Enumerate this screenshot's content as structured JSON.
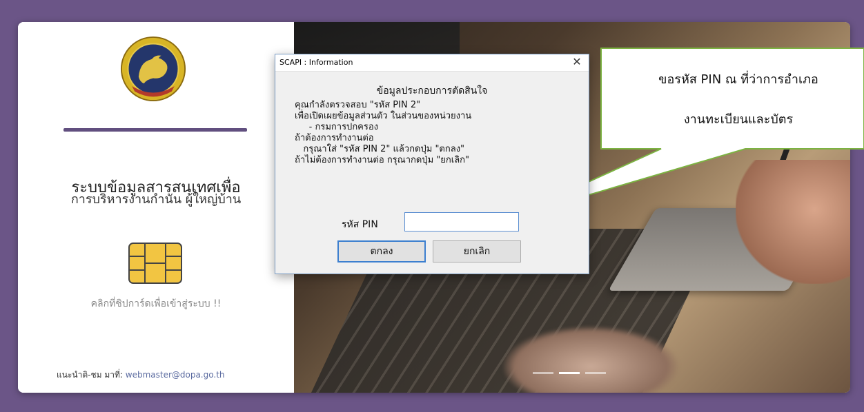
{
  "left_panel": {
    "emblem_alt": "กรมการปกครอง",
    "title_line1": "ระบบข้อมูลสารสนเทศเพื่อ",
    "title_line2": "การบริหารงานกำนัน ผู้ใหญ่บ้าน",
    "chip_icon": "smartcard-chip-icon",
    "click_hint": "คลิกที่ชิปการ์ดเพื่อเข้าสู่ระบบ !!",
    "footer_label": "แนะนำติ-ชม มาที่:",
    "footer_email": "webmaster@dopa.go.th"
  },
  "dialog": {
    "title": "SCAPI : Information",
    "close_label": "✕",
    "heading": "ข้อมูลประกอบการตัดสินใจ",
    "body_lines": [
      "คุณกำลังตรวจสอบ \"รหัส PIN 2\"",
      "เพื่อเปิดเผยข้อมูลส่วนตัว ในส่วนของหน่วยงาน",
      "     - กรมการปกครอง",
      "ถ้าต้องการทำงานต่อ",
      "   กรุณาใส่ \"รหัส PIN 2\" แล้วกดปุ่ม \"ตกลง\"",
      "ถ้าไม่ต้องการทำงานต่อ กรุณากดปุ่ม \"ยกเลิก\""
    ],
    "pin_label": "รหัส PIN",
    "pin_value": "",
    "ok_label": "ตกลง",
    "cancel_label": "ยกเลิก"
  },
  "callout": {
    "line1": "ขอรหัส PIN ณ ที่ว่าการอำเภอ",
    "line2": "งานทะเบียนและบัตร",
    "border_color": "#7cb342"
  },
  "carousel": {
    "slide_count": 3,
    "active_index": 1
  },
  "colors": {
    "background": "#6b5587",
    "divider": "#614f7f",
    "dialog_accent": "#3c7fcf"
  }
}
